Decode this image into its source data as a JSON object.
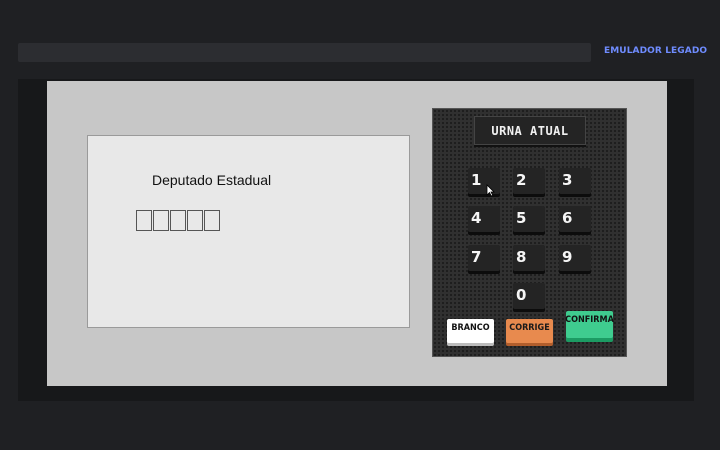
{
  "app": {
    "label": "EMULADOR LEGADO",
    "label_color": "#6f8cff"
  },
  "screen": {
    "office": "Deputado Estadual",
    "digit_count": 5
  },
  "panel": {
    "title": "URNA ATUAL",
    "keys": [
      "1",
      "2",
      "3",
      "4",
      "5",
      "6",
      "7",
      "8",
      "9",
      "0"
    ],
    "actions": {
      "branco": "BRANCO",
      "corrige": "CORRIGE",
      "confirma": "CONFIRMA"
    }
  },
  "colors": {
    "branco": "#ffffff",
    "corrige": "#e88a4e",
    "confirma": "#3fcc8f"
  },
  "icons": {
    "pointer": "mouse-pointer-icon"
  }
}
